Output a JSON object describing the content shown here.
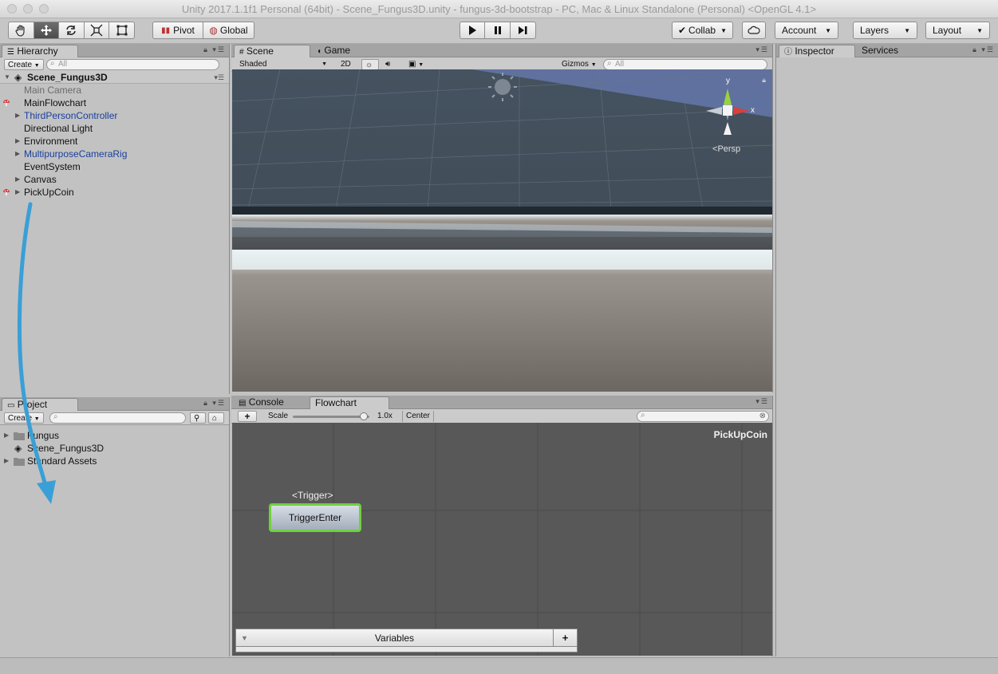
{
  "window": {
    "title": "Unity 2017.1.1f1 Personal (64bit) - Scene_Fungus3D.unity - fungus-3d-bootstrap - PC, Mac & Linux Standalone (Personal) <OpenGL 4.1>"
  },
  "toolbar": {
    "pivot": "Pivot",
    "global": "Global",
    "collab": "Collab",
    "account": "Account",
    "layers": "Layers",
    "layout": "Layout"
  },
  "hierarchy": {
    "tab": "Hierarchy",
    "create": "Create",
    "search_placeholder": "All",
    "scene": "Scene_Fungus3D",
    "items": [
      {
        "label": "Main Camera"
      },
      {
        "label": "MainFlowchart"
      },
      {
        "label": "ThirdPersonController"
      },
      {
        "label": "Directional Light"
      },
      {
        "label": "Environment"
      },
      {
        "label": "MultipurposeCameraRig"
      },
      {
        "label": "EventSystem"
      },
      {
        "label": "Canvas"
      },
      {
        "label": "PickUpCoin"
      }
    ]
  },
  "scene": {
    "tab_scene": "Scene",
    "tab_game": "Game",
    "shading": "Shaded",
    "mode_2d": "2D",
    "gizmos": "Gizmos",
    "search_placeholder": "All",
    "gizmo_y": "y",
    "gizmo_x": "x",
    "persp": "Persp"
  },
  "inspector": {
    "tab": "Inspector",
    "services": "Services"
  },
  "project": {
    "tab": "Project",
    "create": "Create",
    "items": [
      {
        "label": "Fungus"
      },
      {
        "label": "Scene_Fungus3D"
      },
      {
        "label": "Standard Assets"
      }
    ]
  },
  "flowchart": {
    "tab_console": "Console",
    "tab_flowchart": "Flowchart",
    "add": "+",
    "scale_label": "Scale",
    "scale_value": "1.0x",
    "scale_fraction": 0.98,
    "center": "Center",
    "name": "PickUpCoin",
    "block_event": "<Trigger>",
    "block_label": "TriggerEnter",
    "variables": "Variables",
    "variables_add": "+"
  },
  "colors": {
    "block_border": "#6fd13d",
    "annotation_arrow": "#3a9fd6",
    "prefab_blue": "#1a3f9c"
  }
}
